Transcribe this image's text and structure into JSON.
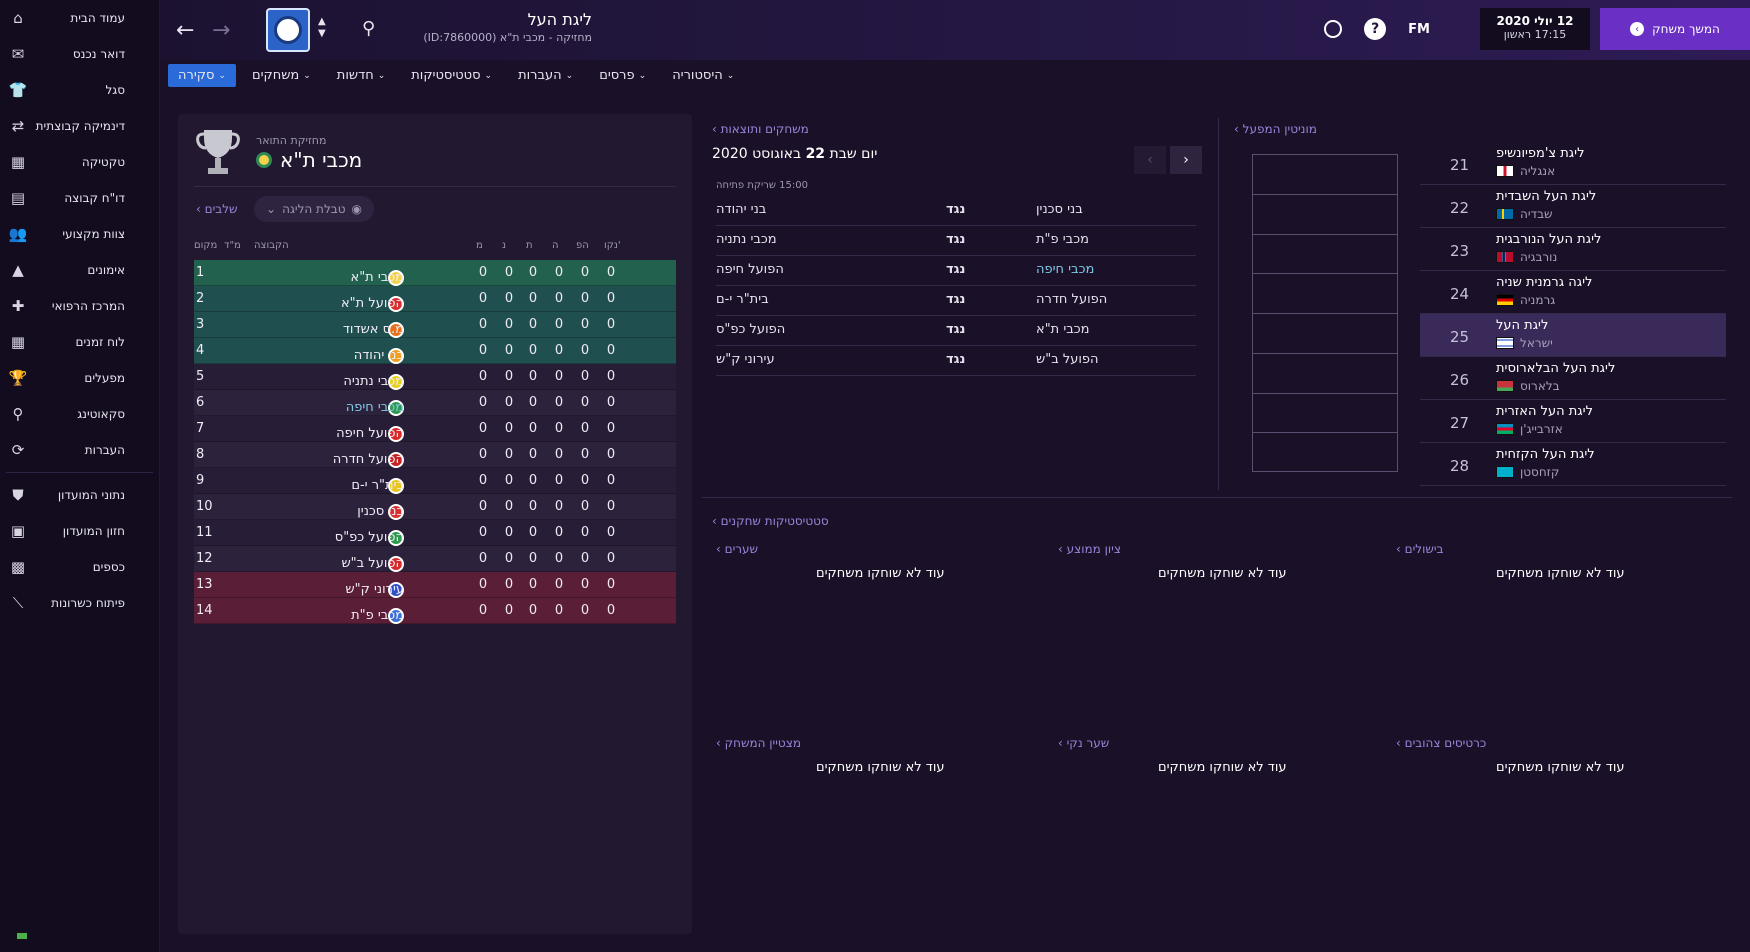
{
  "sidebar": {
    "items": [
      {
        "label": "עמוד הבית",
        "icon": "home-icon",
        "glyph": "⌂"
      },
      {
        "label": "דואר נכנס",
        "icon": "inbox-icon",
        "glyph": "✉"
      },
      {
        "label": "סגל",
        "icon": "squad-icon",
        "glyph": "👕"
      },
      {
        "label": "דינמיקה קבוצתית",
        "icon": "dynamics-icon",
        "glyph": "⇄"
      },
      {
        "label": "טקטיקה",
        "icon": "tactics-icon",
        "glyph": "▦"
      },
      {
        "label": "דו\"ח קבוצה",
        "icon": "report-icon",
        "glyph": "▤"
      },
      {
        "label": "צוות מקצועי",
        "icon": "staff-icon",
        "glyph": "👥"
      },
      {
        "label": "אימונים",
        "icon": "training-icon",
        "glyph": "▲"
      },
      {
        "label": "המרכז הרפואי",
        "icon": "medical-icon",
        "glyph": "✚"
      },
      {
        "label": "לוח זמנים",
        "icon": "calendar-icon",
        "glyph": "▦"
      },
      {
        "label": "מפעלים",
        "icon": "trophy-icon",
        "glyph": "🏆"
      },
      {
        "label": "סקאוטינג",
        "icon": "scouting-icon",
        "glyph": "⚲"
      },
      {
        "label": "העברות",
        "icon": "transfers-icon",
        "glyph": "⟳"
      },
      {
        "label": "נתוני המועדון",
        "icon": "club-info-icon",
        "glyph": "⛊"
      },
      {
        "label": "חזון המועדון",
        "icon": "club-vision-icon",
        "glyph": "▣"
      },
      {
        "label": "כספים",
        "icon": "finances-icon",
        "glyph": "▩"
      },
      {
        "label": "פיתוח כשרונות",
        "icon": "development-icon",
        "glyph": "⟋"
      }
    ]
  },
  "header": {
    "title": "ליגת העל",
    "subtitle": "מחזיקה - מכבי ת\"א (ID:7860000)",
    "fm": "FM",
    "date_line1": "12 יולי 2020",
    "date_line2": "17:15 ראשון",
    "continue_label": "המשך משחק"
  },
  "tabs": [
    {
      "label": "סקירה",
      "active": true
    },
    {
      "label": "משחקים"
    },
    {
      "label": "חדשות"
    },
    {
      "label": "סטטיסטיקות"
    },
    {
      "label": "העברות"
    },
    {
      "label": "פרסים"
    },
    {
      "label": "היסטוריה"
    }
  ],
  "league_panel": {
    "holder_label": "מחזיקת התואר",
    "holder_name": "מכבי ת\"א",
    "stages_link": "שלבים",
    "table_dropdown": "טבלת הליגה",
    "headers": {
      "pos": "מקום",
      "form": "מ\"ד",
      "team": "הקבוצה",
      "played": "מ",
      "won": "נ",
      "drawn": "ת",
      "lost": "ה",
      "gd": "הפ",
      "pts": "נקו'"
    },
    "rows": [
      {
        "pos": "1",
        "team": "מכבי ת\"א",
        "crest": "#f4d24a",
        "vals": [
          "0",
          "0",
          "0",
          "0",
          "0",
          "0"
        ],
        "zone": "promo p1"
      },
      {
        "pos": "2",
        "team": "הפועל ת\"א",
        "crest": "#d83030",
        "vals": [
          "0",
          "0",
          "0",
          "0",
          "0",
          "0"
        ],
        "zone": "promo"
      },
      {
        "pos": "3",
        "team": "מ.ס אשדוד",
        "crest": "#e8701a",
        "vals": [
          "0",
          "0",
          "0",
          "0",
          "0",
          "0"
        ],
        "zone": "promo"
      },
      {
        "pos": "4",
        "team": "בני יהודה",
        "crest": "#f0a020",
        "vals": [
          "0",
          "0",
          "0",
          "0",
          "0",
          "0"
        ],
        "zone": "promo"
      },
      {
        "pos": "5",
        "team": "מכבי נתניה",
        "crest": "#e8d020",
        "vals": [
          "0",
          "0",
          "0",
          "0",
          "0",
          "0"
        ],
        "zone": "norm"
      },
      {
        "pos": "6",
        "team": "מכבי חיפה",
        "crest": "#2e9a4e",
        "vals": [
          "0",
          "0",
          "0",
          "0",
          "0",
          "0"
        ],
        "zone": "norm",
        "link": true
      },
      {
        "pos": "7",
        "team": "הפועל חיפה",
        "crest": "#d82828",
        "vals": [
          "0",
          "0",
          "0",
          "0",
          "0",
          "0"
        ],
        "zone": "norm"
      },
      {
        "pos": "8",
        "team": "הפועל חדרה",
        "crest": "#c82020",
        "vals": [
          "0",
          "0",
          "0",
          "0",
          "0",
          "0"
        ],
        "zone": "norm"
      },
      {
        "pos": "9",
        "team": "בית\"ר י-ם",
        "crest": "#e8c820",
        "vals": [
          "0",
          "0",
          "0",
          "0",
          "0",
          "0"
        ],
        "zone": "norm"
      },
      {
        "pos": "10",
        "team": "בני סכנין",
        "crest": "#d83030",
        "vals": [
          "0",
          "0",
          "0",
          "0",
          "0",
          "0"
        ],
        "zone": "norm"
      },
      {
        "pos": "11",
        "team": "הפועל כפ\"ס",
        "crest": "#2e9a4e",
        "vals": [
          "0",
          "0",
          "0",
          "0",
          "0",
          "0"
        ],
        "zone": "norm"
      },
      {
        "pos": "12",
        "team": "הפועל ב\"ש",
        "crest": "#d82828",
        "vals": [
          "0",
          "0",
          "0",
          "0",
          "0",
          "0"
        ],
        "zone": "norm"
      },
      {
        "pos": "13",
        "team": "עירוני ק\"ש",
        "crest": "#3050c8",
        "vals": [
          "0",
          "0",
          "0",
          "0",
          "0",
          "0"
        ],
        "zone": "rel"
      },
      {
        "pos": "14",
        "team": "מכבי פ\"ת",
        "crest": "#3a70d8",
        "vals": [
          "0",
          "0",
          "0",
          "0",
          "0",
          "0"
        ],
        "zone": "rel"
      }
    ]
  },
  "fixtures": {
    "title": "משחקים ותוצאות",
    "date_prefix": "יום שבת",
    "date_day": "22",
    "date_rest": "באוגוסט 2020",
    "kickoff": "15:00 שריקת פתיחה",
    "vs": "נגד",
    "rows": [
      {
        "home": "בני יהודה",
        "away": "בני סכנין"
      },
      {
        "home": "מכבי נתניה",
        "away": "מכבי פ\"ת"
      },
      {
        "home": "הפועל חיפה",
        "away": "מכבי חיפה",
        "away_link": true
      },
      {
        "home": "בית\"ר י-ם",
        "away": "הפועל חדרה"
      },
      {
        "home": "הפועל כפ\"ס",
        "away": "מכבי ת\"א"
      },
      {
        "home": "עירוני ק\"ש",
        "away": "הפועל ב\"ש"
      }
    ]
  },
  "reputation": {
    "title": "מוניטין המפעל",
    "rankings": [
      {
        "num": "21",
        "name": "ליגת צ'מפיונשיפ",
        "country": "אנגליה",
        "flag": "england"
      },
      {
        "num": "22",
        "name": "ליגת העל השבדית",
        "country": "שבדיה",
        "flag": "sweden"
      },
      {
        "num": "23",
        "name": "ליגת העל הנורבגית",
        "country": "נורבגיה",
        "flag": "norway"
      },
      {
        "num": "24",
        "name": "ליגה גרמנית שניה",
        "country": "גרמניה",
        "flag": "germany"
      },
      {
        "num": "25",
        "name": "ליגת העל",
        "country": "ישראל",
        "flag": "israel",
        "active": true
      },
      {
        "num": "26",
        "name": "ליגת העל הבלארוסית",
        "country": "בלארוס",
        "flag": "belarus"
      },
      {
        "num": "27",
        "name": "ליגת העל האזרית",
        "country": "אזרבייג'ן",
        "flag": "azerbaijan"
      },
      {
        "num": "28",
        "name": "ליגת העל הקזחית",
        "country": "קזחסטן",
        "flag": "kazakhstan"
      }
    ]
  },
  "player_stats": {
    "title": "סטטיסטיקות שחקנים",
    "empty": "עוד לא שוחקו משחקים",
    "blocks": [
      {
        "title": "שערים"
      },
      {
        "title": "ציון ממוצע"
      },
      {
        "title": "בישולים"
      },
      {
        "title": "מצטיין המשחק"
      },
      {
        "title": "שער נקי"
      },
      {
        "title": "כרטיסים צהובים"
      }
    ]
  },
  "colors": {
    "accent": "#6a2fc4",
    "tab_active": "#2a6ad9",
    "link": "#9b84d8",
    "promo": "#1f4f4e",
    "relegation": "#5a1e36"
  }
}
